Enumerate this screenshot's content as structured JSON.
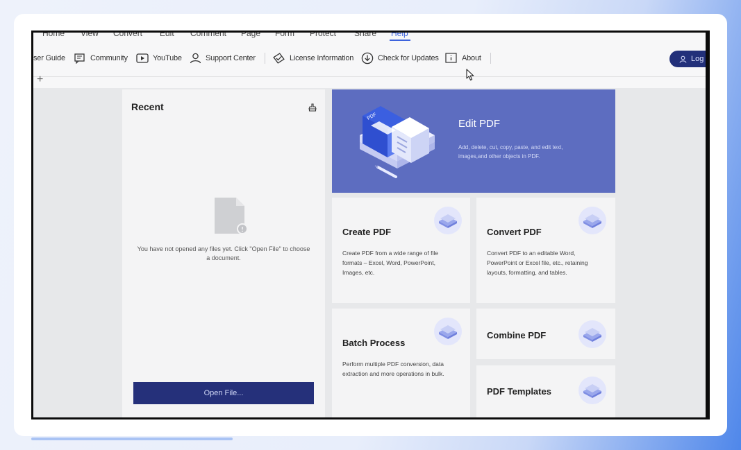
{
  "menu": {
    "items": [
      "Home",
      "View",
      "Convert",
      "Edit",
      "Comment",
      "Page",
      "Form",
      "Protect",
      "Share",
      "Help"
    ],
    "active": "Help"
  },
  "toolbar": {
    "user_guide": "ser Guide",
    "community": "Community",
    "youtube": "YouTube",
    "support_center": "Support Center",
    "license_information": "License Information",
    "check_for_updates": "Check for Updates",
    "about": "About",
    "login": "Log"
  },
  "tabs": {
    "new_tab": "+"
  },
  "recent": {
    "title": "Recent",
    "empty_message": "You have not opened any files yet. Click \"Open File\" to choose a document.",
    "open_button": "Open File..."
  },
  "edit_pdf": {
    "title": "Edit PDF",
    "description": "Add, delete, cut, copy, paste, and edit text, images,and other objects in PDF.",
    "art_label": "PDF"
  },
  "tiles": {
    "create_pdf": {
      "title": "Create PDF",
      "description": "Create PDF from a wide range of file formats – Excel, Word, PowerPoint, Images, etc."
    },
    "convert_pdf": {
      "title": "Convert PDF",
      "description": "Convert PDF to an editable Word, PowerPoint or Excel file, etc., retaining layouts, formatting, and tables."
    },
    "batch_process": {
      "title": "Batch Process",
      "description": "Perform multiple PDF conversion, data extraction and more operations in bulk."
    },
    "combine_pdf": {
      "title": "Combine PDF"
    },
    "pdf_templates": {
      "title": "PDF Templates"
    }
  },
  "colors": {
    "accent": "#3d63dd",
    "hero_bg": "#5d6dc0",
    "button_dark": "#25307a"
  },
  "icons": {
    "toolbar": [
      "book-icon",
      "community-icon",
      "youtube-icon",
      "person-icon",
      "license-icon",
      "download-icon",
      "info-icon"
    ],
    "tiles": [
      "stack-icon"
    ]
  }
}
